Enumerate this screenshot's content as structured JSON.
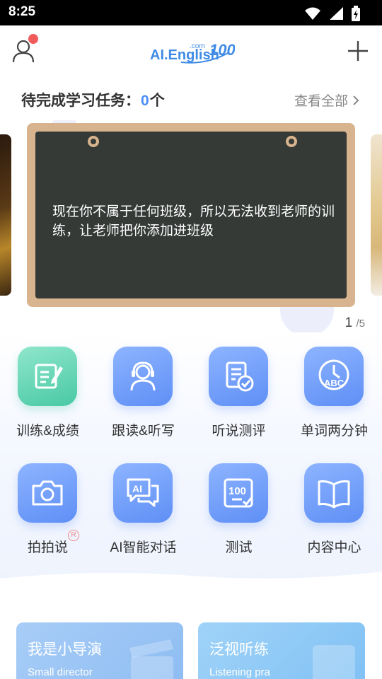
{
  "status_bar": {
    "time": "8:25"
  },
  "header": {
    "logo_text": "AI.English",
    "logo_sup": ".com",
    "logo_num": "100"
  },
  "tasks": {
    "title": "待完成学习任务：",
    "count": "0",
    "unit": "个",
    "view_all": "查看全部"
  },
  "banner": {
    "message": "现在你不属于任何班级，所以无法收到老师的训练，让老师把你添加进班级",
    "page_current": "1",
    "page_total": "/5"
  },
  "grid": [
    {
      "label": "训练&成绩",
      "icon": "edit-icon"
    },
    {
      "label": "跟读&听写",
      "icon": "headset-user-icon"
    },
    {
      "label": "听说测评",
      "icon": "document-check-icon"
    },
    {
      "label": "单词两分钟",
      "icon": "clock-abc-icon"
    },
    {
      "label": "拍拍说",
      "icon": "camera-icon",
      "badge": "R"
    },
    {
      "label": "AI智能对话",
      "icon": "ai-chat-icon"
    },
    {
      "label": "测试",
      "icon": "test-100-icon"
    },
    {
      "label": "内容中心",
      "icon": "book-icon"
    }
  ],
  "cards": [
    {
      "title": "我是小导演",
      "subtitle": "Small director"
    },
    {
      "title": "泛视听练",
      "subtitle": "Listening pra"
    }
  ],
  "colors": {
    "accent": "#4b8ef7",
    "tile_blue": "#6a97f6",
    "tile_green": "#4fcca7",
    "board": "#353a37",
    "board_frame": "#d8b48e",
    "badge_red": "#f25b5b"
  }
}
